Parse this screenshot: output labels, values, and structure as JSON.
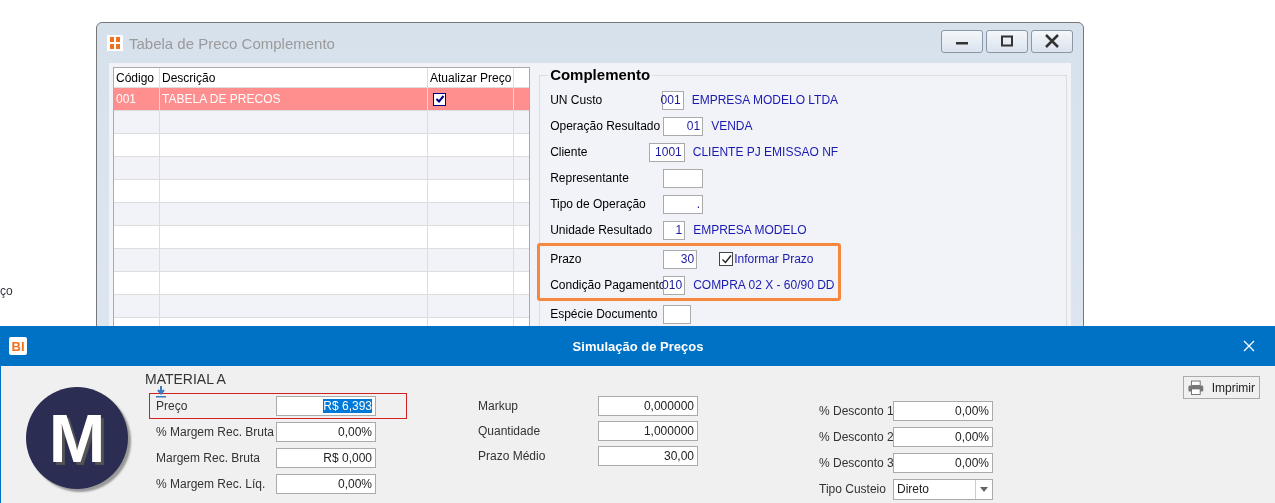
{
  "background_text": "ço",
  "back_window": {
    "title": "Tabela de Preco Complemento",
    "table": {
      "columns": [
        "Código",
        "Descrição",
        "Atualizar Preço"
      ],
      "rows": [
        {
          "codigo": "001",
          "descricao": "TABELA DE PRECOS",
          "atualizar": true,
          "selected": true
        }
      ]
    },
    "complemento": {
      "title": "Complemento",
      "sections": [
        {
          "highlighted": false,
          "fields": [
            {
              "label": "UN Custo",
              "code": "001",
              "description": "EMPRESA MODELO LTDA"
            },
            {
              "label": "Operação Resultado",
              "code": "01",
              "description": "VENDA"
            },
            {
              "label": "Cliente",
              "code": "1001",
              "description": "CLIENTE PJ EMISSAO NF"
            },
            {
              "label": "Representante"
            },
            {
              "label": "Tipo de Operação",
              "code": "."
            },
            {
              "label": "Unidade Resultado",
              "code": "1",
              "description": "EMPRESA MODELO"
            }
          ]
        },
        {
          "highlighted": true,
          "fields": [
            {
              "label": "Prazo",
              "code": "30",
              "checkbox": {
                "label": "Informar Prazo",
                "checked": true
              }
            },
            {
              "label": "Condição Pagamento",
              "code": "010",
              "description": "COMPRA 02 X - 60/90 DD"
            }
          ]
        },
        {
          "highlighted": false,
          "fields": [
            {
              "label": "Espécie Documento"
            }
          ]
        }
      ]
    }
  },
  "dialog": {
    "logo_text": "BI",
    "title": "Simulação de Preços",
    "avatar_letter": "M",
    "material": "MATERIAL A",
    "print_button": "Imprimir",
    "columns": [
      [
        {
          "kind": "input",
          "label": "Preço",
          "value": "R$ 6,393",
          "highlighted": true,
          "text_selected": true
        },
        {
          "kind": "input",
          "label": "% Margem Rec. Bruta",
          "value": "0,00%",
          "highlighted": false,
          "text_selected": false
        },
        {
          "kind": "input",
          "label": "Margem Rec. Bruta",
          "value": "R$ 0,000",
          "highlighted": false,
          "text_selected": false
        },
        {
          "kind": "input",
          "label": "% Margem Rec. Líq.",
          "value": "0,00%",
          "highlighted": false,
          "text_selected": false
        }
      ],
      [
        {
          "kind": "input",
          "label": "Markup",
          "value": "0,000000",
          "highlighted": false,
          "text_selected": false
        },
        {
          "kind": "input",
          "label": "Quantidade",
          "value": "1,000000",
          "highlighted": false,
          "text_selected": false
        },
        {
          "kind": "input",
          "label": "Prazo Médio",
          "value": "30,00",
          "highlighted": false,
          "text_selected": false
        }
      ],
      [
        {
          "kind": "input",
          "label": "% Desconto 1",
          "value": "0,00%",
          "highlighted": false,
          "text_selected": false
        },
        {
          "kind": "input",
          "label": "% Desconto 2",
          "value": "0,00%",
          "highlighted": false,
          "text_selected": false
        },
        {
          "kind": "input",
          "label": "% Desconto 3",
          "value": "0,00%",
          "highlighted": false,
          "text_selected": false
        },
        {
          "kind": "select",
          "label": "Tipo Custeio",
          "value": "Direto",
          "highlighted": false,
          "text_selected": false
        }
      ]
    ]
  }
}
